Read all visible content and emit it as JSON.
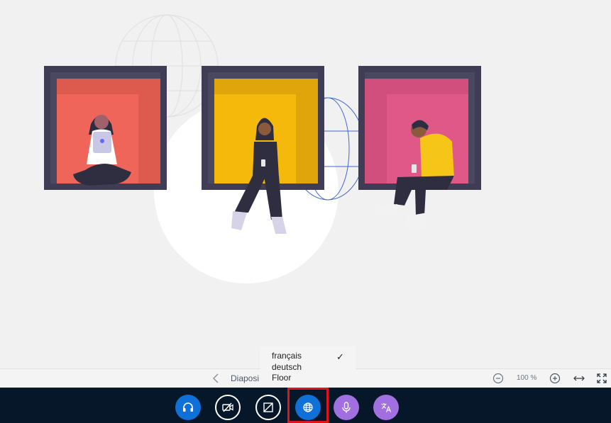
{
  "slide_toolbar": {
    "prev_icon": "chevron-left-icon",
    "slide_label": "Diaposi",
    "zoom_level": "100 %",
    "zoom_out_icon": "minus-circle-icon",
    "zoom_in_icon": "plus-circle-icon",
    "fit_width_icon": "arrows-horizontal-icon",
    "fullscreen_icon": "fullscreen-icon"
  },
  "language_menu": {
    "items": [
      {
        "label": "français",
        "selected": true
      },
      {
        "label": "deutsch",
        "selected": false
      },
      {
        "label": "Floor",
        "selected": false
      }
    ],
    "check_mark": "✓"
  },
  "action_bar": {
    "buttons": [
      {
        "name": "audio-button",
        "icon": "headphones-icon"
      },
      {
        "name": "camera-button",
        "icon": "video-off-icon"
      },
      {
        "name": "screen-share-button",
        "icon": "screen-share-off-icon"
      },
      {
        "name": "interpretation-button",
        "icon": "globe-icon"
      },
      {
        "name": "microphone-button",
        "icon": "microphone-icon"
      },
      {
        "name": "translate-button",
        "icon": "translate-icon"
      }
    ]
  },
  "colors": {
    "action_bar_bg": "#06172a",
    "primary_blue": "#0f70d7",
    "purple": "#a16fe0",
    "highlight_red": "#e0141c",
    "frame_dark": "#3f3d56",
    "frame_red_inner": "#f0655a",
    "frame_yellow_inner": "#f5b90b",
    "frame_pink_inner": "#e05887",
    "globe_blue": "#3c5fd0"
  }
}
